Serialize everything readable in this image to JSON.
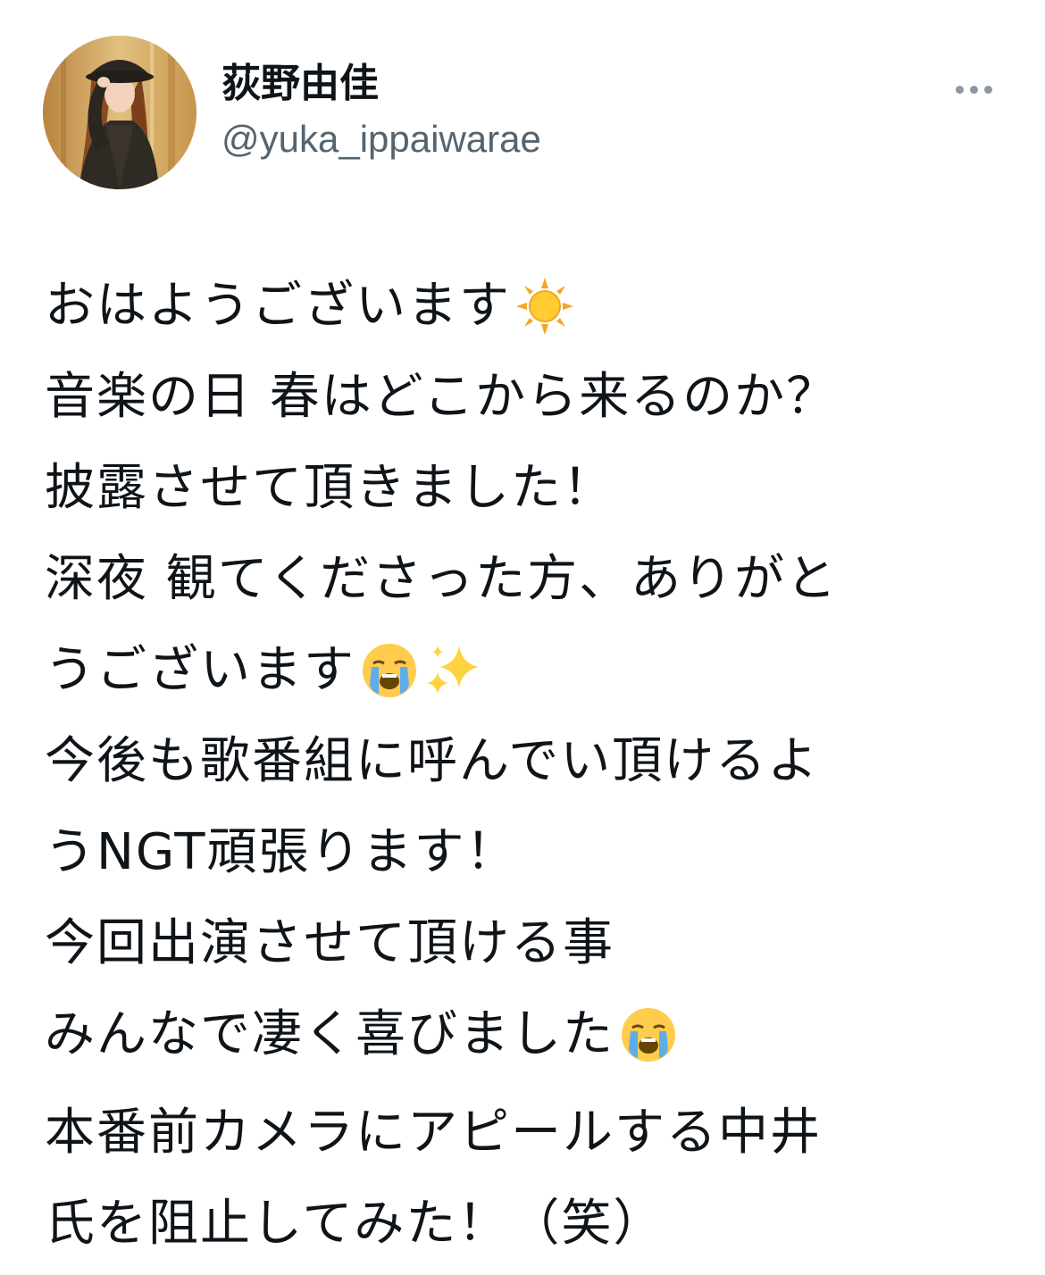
{
  "user": {
    "display_name": "荻野由佳",
    "handle": "@yuka_ippaiwarae"
  },
  "menu": {
    "icon": "more-horizontal-icon"
  },
  "tweet": {
    "lines": [
      {
        "text": "おはようございます",
        "emoji": [
          "sun-emoji"
        ]
      },
      {
        "text": "音楽の日 春はどこから来るのか？",
        "emoji": []
      },
      {
        "text": "披露させて頂きました！",
        "emoji": []
      },
      {
        "text": "深夜 観てくださった方、ありがと",
        "emoji": []
      },
      {
        "text": "うございます",
        "emoji": [
          "crying-face-emoji",
          "sparkles-emoji"
        ]
      },
      {
        "text": "今後も歌番組に呼んでい頂けるよ",
        "emoji": []
      },
      {
        "text": "うNGT頑張ります！",
        "emoji": []
      },
      {
        "text": "今回出演させて頂ける事",
        "emoji": []
      },
      {
        "text": "みんなで凄く喜びました",
        "emoji": [
          "crying-face-emoji"
        ]
      }
    ],
    "lines2": [
      {
        "text": "本番前カメラにアピールする中井",
        "emoji": []
      },
      {
        "text": "氏を阻止してみた！（笑）",
        "emoji": []
      }
    ]
  },
  "colors": {
    "text": "#0f1419",
    "secondary": "#536471",
    "more_dots": "#8b98a5"
  }
}
